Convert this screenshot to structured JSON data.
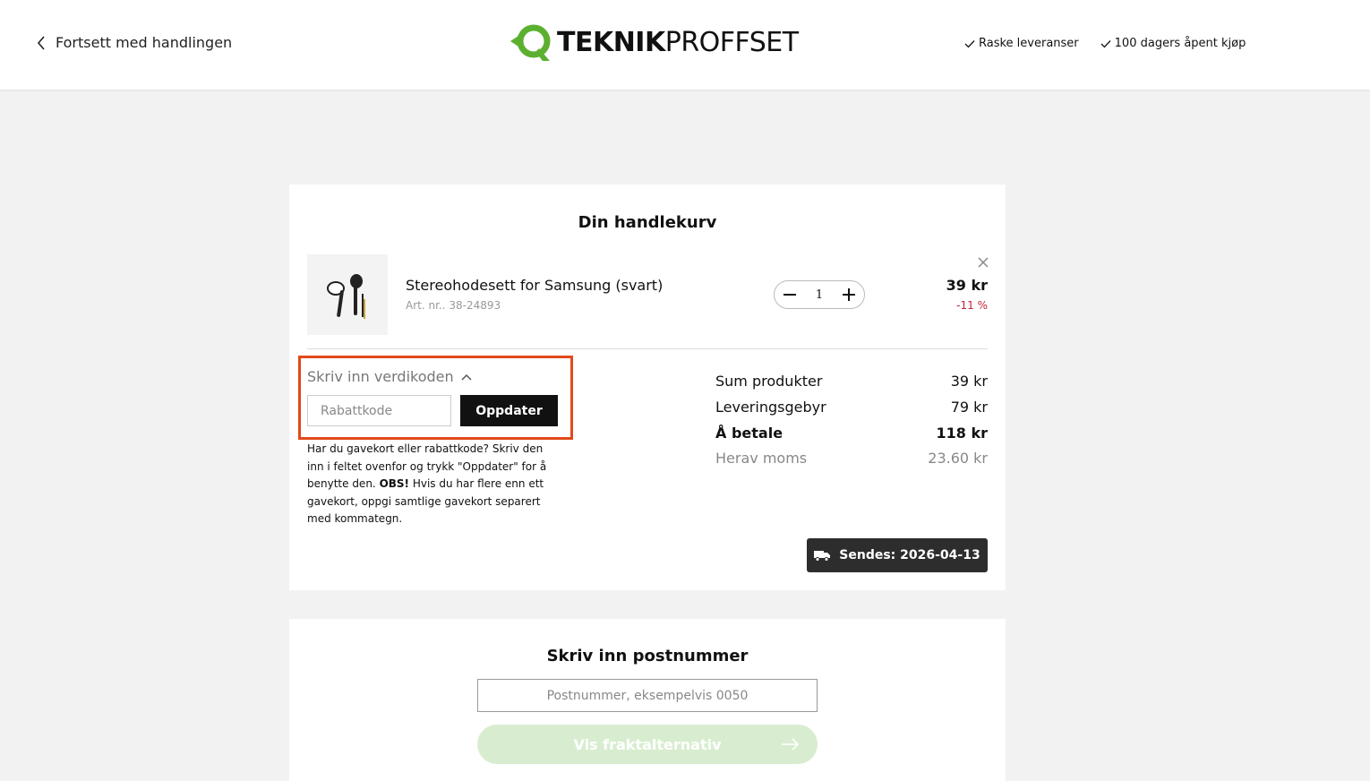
{
  "header": {
    "back_label": "Fortsett med handlingen",
    "logo": {
      "part1": "TEKNIK",
      "part2": "PROFFSET",
      "brand_color": "#5cb030"
    },
    "usps": [
      "Raske leveranser",
      "100 dagers åpent kjøp"
    ]
  },
  "cart": {
    "title": "Din handlekurv",
    "item": {
      "name": "Stereohodesett for Samsung (svart)",
      "article": "Art. nr.. 38-24893",
      "quantity": "1",
      "price": "39 kr",
      "discount": "-11 %"
    },
    "voucher": {
      "toggle_label": "Skriv inn verdikoden",
      "input_placeholder": "Rabattkode",
      "button_label": "Oppdater",
      "help_before": "Har du gavekort eller rabattkode? Skriv den inn i feltet ovenfor og trykk \"Oppdater\" for å benytte den. ",
      "help_bold": "OBS!",
      "help_after": " Hvis du har flere enn ett gavekort, oppgi samtlige gavekort separert med kommategn.",
      "highlight_color": "#e24a1b"
    },
    "summary": [
      {
        "label": "Sum produkter",
        "value": "39 kr"
      },
      {
        "label": "Leveringsgebyr",
        "value": "79 kr"
      },
      {
        "label": "Å betale",
        "value": "118 kr"
      },
      {
        "label": "Herav moms",
        "value": "23.60 kr"
      }
    ],
    "ship_date": "Sendes: 2026-04-13"
  },
  "postal": {
    "title": "Skriv inn postnummer",
    "input_placeholder": "Postnummer, eksempelvis 0050",
    "button_label": "Vis fraktalternativ",
    "button_color": "#d8edd0"
  }
}
